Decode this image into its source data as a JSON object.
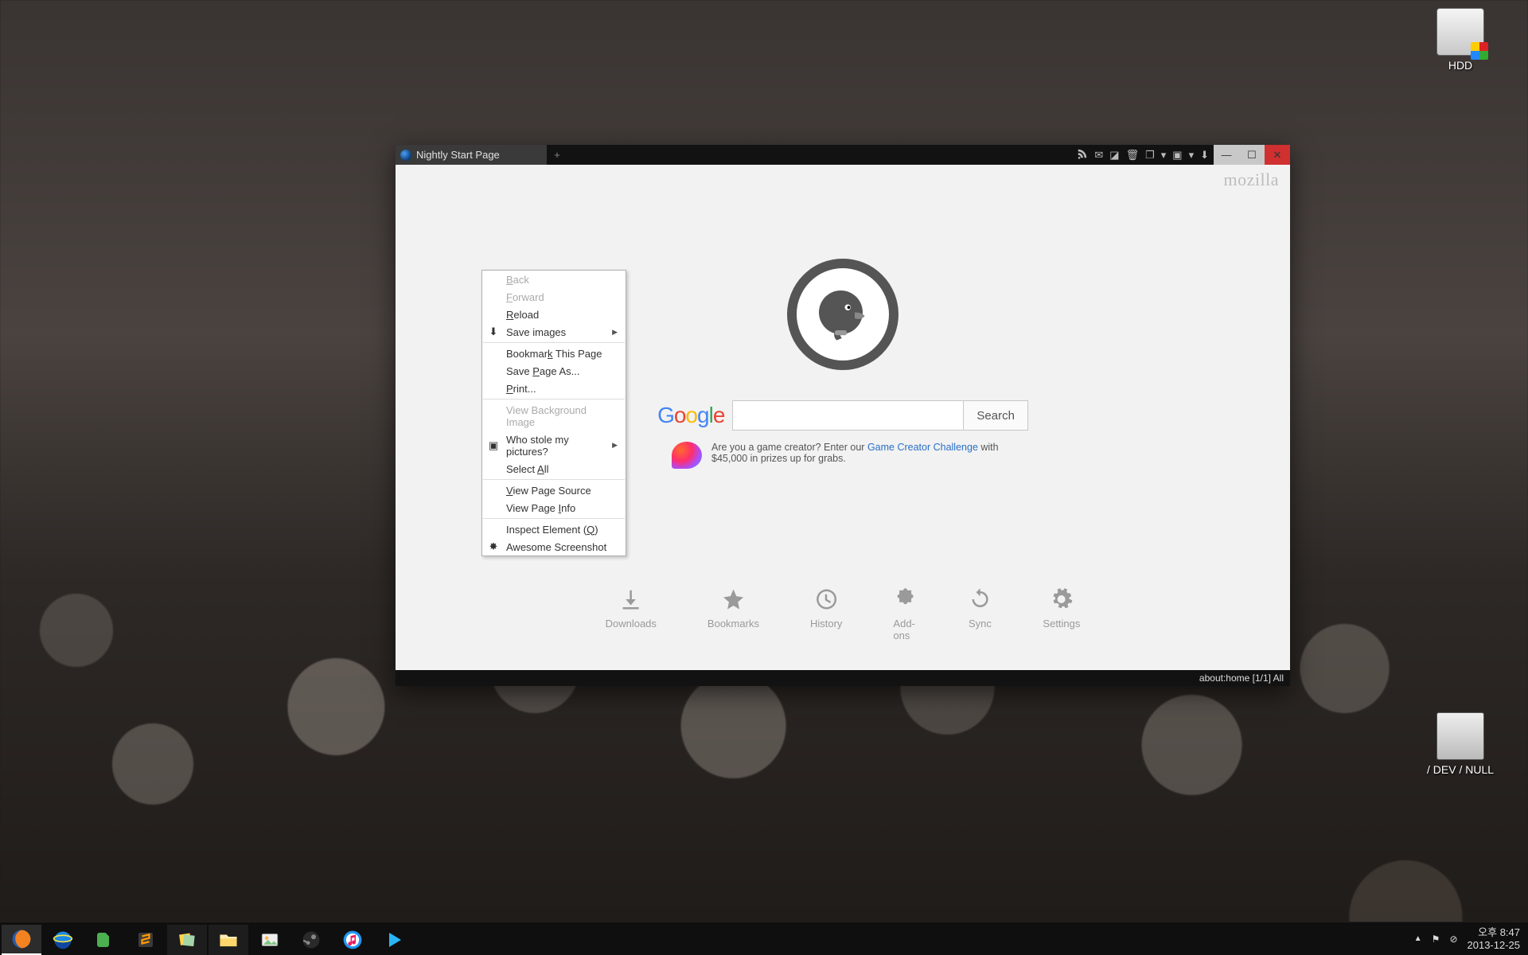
{
  "desktop": {
    "hdd_label": "HDD",
    "recycle_label": "/ DEV / NULL"
  },
  "browser": {
    "tab_title": "Nightly Start Page",
    "brand": "mozilla",
    "search_button": "Search",
    "promo_pre": "Are you a game creator? Enter our ",
    "promo_link": "Game Creator Challenge",
    "promo_post": " with $45,000 in prizes up for grabs.",
    "launchers": {
      "downloads": "Downloads",
      "bookmarks": "Bookmarks",
      "history": "History",
      "addons": "Add-ons",
      "sync": "Sync",
      "settings": "Settings"
    },
    "status": "about:home  [1/1] All"
  },
  "context_menu": {
    "back": "Back",
    "forward": "Forward",
    "reload": "Reload",
    "save_images": "Save images",
    "bookmark": "Bookmark This Page",
    "save_page_as": "Save Page As...",
    "print": "Print...",
    "view_bg": "View Background Image",
    "who_stole": "Who stole my pictures?",
    "select_all": "Select All",
    "view_source": "View Page Source",
    "view_info": "View Page Info",
    "inspect": "Inspect Element (Q)",
    "awesome": "Awesome Screenshot"
  },
  "systray": {
    "time": "오후 8:47",
    "date": "2013-12-25"
  }
}
